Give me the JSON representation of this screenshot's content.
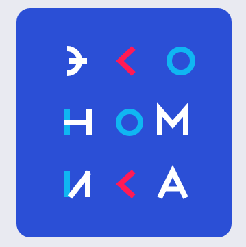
{
  "logo": {
    "wordmark": "ЭКОНОМИКА",
    "rows": [
      {
        "letters": [
          "Э",
          "К",
          "О"
        ]
      },
      {
        "letters": [
          "Н",
          "О",
          "М"
        ]
      },
      {
        "letters": [
          "И",
          "К",
          "А"
        ]
      }
    ]
  },
  "colors": {
    "page_background": "#e9eaf1",
    "tile_background": "#2b4fd6",
    "white": "#ffffff",
    "cyan": "#10b6f2",
    "red": "#ff1a55"
  }
}
